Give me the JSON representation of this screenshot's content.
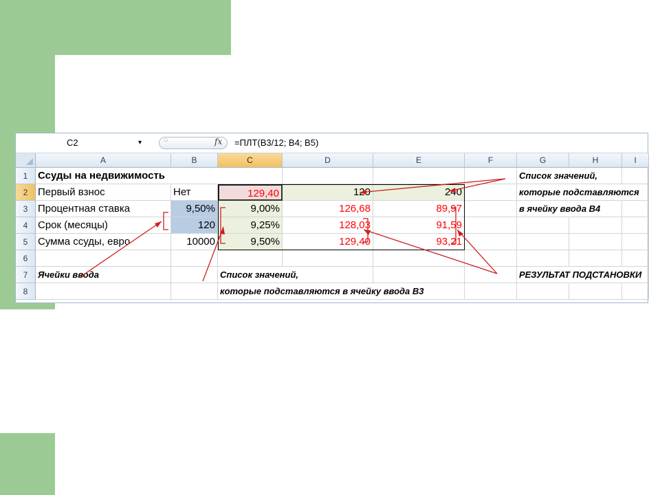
{
  "formula_bar": {
    "name_box": "C2",
    "name_box_arrow": "▾",
    "fx_label": "fx",
    "formula": "=ПЛТ(B3/12; B4; B5)"
  },
  "columns": [
    "A",
    "B",
    "C",
    "D",
    "E",
    "F",
    "G",
    "H",
    "I"
  ],
  "rows": [
    "1",
    "2",
    "3",
    "4",
    "5",
    "6",
    "7",
    "8"
  ],
  "cells": {
    "A1": "Ссуды на недвижимость",
    "A2": "Первый взнос",
    "B2": "Нет",
    "C2": "129,40",
    "D2": "120",
    "E2": "240",
    "A3": "Процентная ставка",
    "B3": "9,50%",
    "C3": "9,00%",
    "D3": "126,68",
    "E3": "89,97",
    "A4": "Срок (месяцы)",
    "B4": "120",
    "C4": "9,25%",
    "D4": "128,03",
    "E4": "91,59",
    "A5": "Сумма ссуды, евро",
    "B5": "10000",
    "C5": "9,50%",
    "D5": "129,40",
    "E5": "93,21",
    "A7": "Ячейки ввода",
    "C7": "Список значений,",
    "C8": "которые подставляются в ячейку ввода B3",
    "G1": "Список значений,",
    "G2": "которые подставляются",
    "G3": "в ячейку ввода B4",
    "G7": "РЕЗУЛЬТАТ ПОДСТАНОВКИ"
  },
  "colors": {
    "slide_accent": "#9cca95",
    "result_red": "#ff0000",
    "input_blue": "#b8cce4",
    "list_green": "#ebf1de",
    "formula_pink": "#f2dcdb",
    "selected_header": "#f1c15f"
  }
}
